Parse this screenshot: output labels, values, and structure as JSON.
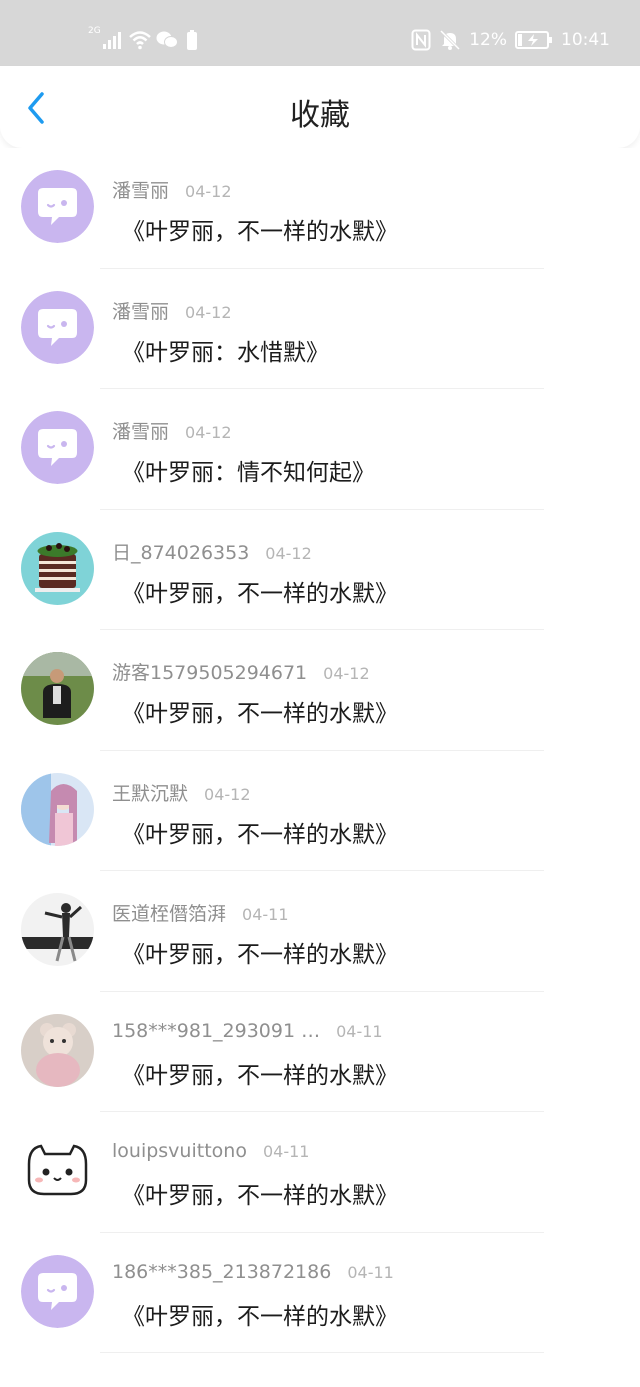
{
  "status_bar": {
    "network": "2G",
    "battery_percent": "12%",
    "time": "10:41"
  },
  "header": {
    "title": "收藏"
  },
  "colors": {
    "accent": "#1e9bf0",
    "status_bar_bg": "#d7d7d7",
    "default_avatar_bg": "#c9b6ef"
  },
  "items": [
    {
      "username": "潘雪丽",
      "date": "04-12",
      "content": "《叶罗丽，不一样的水默》",
      "avatar": "default-chat-avatar"
    },
    {
      "username": "潘雪丽",
      "date": "04-12",
      "content": "《叶罗丽：水惜默》",
      "avatar": "default-chat-avatar"
    },
    {
      "username": "潘雪丽",
      "date": "04-12",
      "content": "《叶罗丽：情不知何起》",
      "avatar": "default-chat-avatar"
    },
    {
      "username": "日_874026353",
      "date": "04-12",
      "content": "《叶罗丽，不一样的水默》",
      "avatar": "cake-photo-avatar"
    },
    {
      "username": "游客1579505294671",
      "date": "04-12",
      "content": "《叶罗丽，不一样的水默》",
      "avatar": "person-outdoor-avatar"
    },
    {
      "username": "王默沉默",
      "date": "04-12",
      "content": "《叶罗丽，不一样的水默》",
      "avatar": "anime-girl-avatar"
    },
    {
      "username": "医道桎僭箔湃",
      "date": "04-11",
      "content": "《叶罗丽，不一样的水默》",
      "avatar": "dancer-avatar"
    },
    {
      "username": "158***981_293091 …",
      "date": "04-11",
      "content": "《叶罗丽，不一样的水默》",
      "avatar": "teddy-bear-avatar"
    },
    {
      "username": "louipsvuittono",
      "date": "04-11",
      "content": "《叶罗丽，不一样的水默》",
      "avatar": "cartoon-cat-avatar"
    },
    {
      "username": "186***385_213872186",
      "date": "04-11",
      "content": "《叶罗丽，不一样的水默》",
      "avatar": "default-chat-avatar"
    }
  ]
}
